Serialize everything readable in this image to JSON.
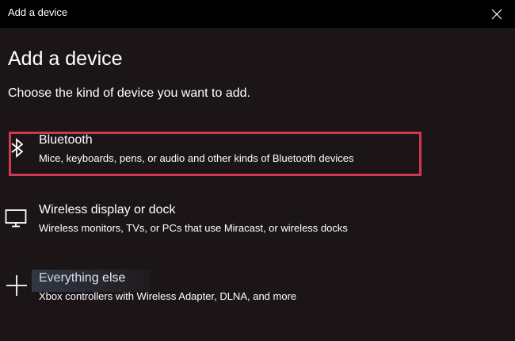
{
  "window": {
    "title": "Add a device"
  },
  "page": {
    "title": "Add a device",
    "subtitle": "Choose the kind of device you want to add."
  },
  "options": [
    {
      "name": "Bluetooth",
      "description": "Mice, keyboards, pens, or audio and other kinds of Bluetooth devices",
      "icon": "bluetooth-icon"
    },
    {
      "name": "Wireless display or dock",
      "description": "Wireless monitors, TVs, or PCs that use Miracast, or wireless docks",
      "icon": "monitor-icon"
    },
    {
      "name": "Everything else",
      "description": "Xbox controllers with Wireless Adapter, DLNA, and more",
      "icon": "plus-icon"
    }
  ],
  "colors": {
    "background": "#1b1517",
    "titlebar": "#000000",
    "text": "#ffffff",
    "highlight": "#d0384c"
  }
}
